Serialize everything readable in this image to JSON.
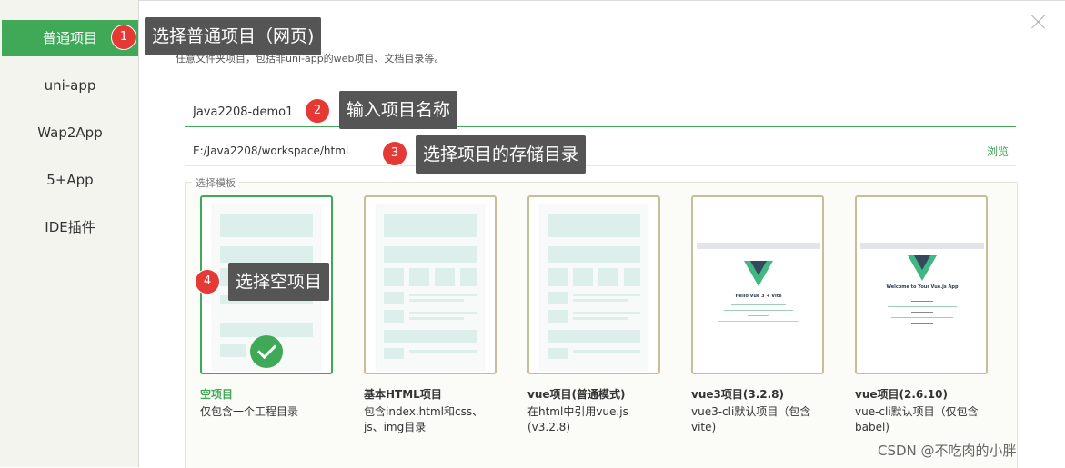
{
  "sidebar": {
    "items": [
      {
        "label": "普通项目",
        "active": true
      },
      {
        "label": "uni-app"
      },
      {
        "label": "Wap2App"
      },
      {
        "label": "5+App"
      },
      {
        "label": "IDE插件"
      }
    ]
  },
  "form": {
    "description": "任意文件夹项目，包括非uni-app的web项目、文档目录等。",
    "project_name": "Java2208-demo1",
    "project_path": "E:/Java2208/workspace/html",
    "browse_label": "浏览",
    "template_legend": "选择模板"
  },
  "templates": [
    {
      "title": "空项目",
      "desc": "仅包含一个工程目录",
      "selected": true
    },
    {
      "title": "基本HTML项目",
      "desc": "包含index.html和css、js、img目录"
    },
    {
      "title": "vue项目(普通模式)",
      "desc": "在html中引用vue.js (v3.2.8)"
    },
    {
      "title": "vue3项目(3.2.8)",
      "desc": "vue3-cli默认项目（包含vite)",
      "preview_title": "Hello Vue 3 + Vite"
    },
    {
      "title": "vue项目(2.6.10)",
      "desc": "vue-cli默认项目（仅包含babel)",
      "preview_title": "Welcome to Your Vue.js App"
    }
  ],
  "annotations": [
    {
      "num": "1",
      "text": "选择普通项目（网页)"
    },
    {
      "num": "2",
      "text": "输入项目名称"
    },
    {
      "num": "3",
      "text": "选择项目的存储目录"
    },
    {
      "num": "4",
      "text": "选择空项目"
    }
  ],
  "watermark": "CSDN @不吃肉的小胖",
  "colors": {
    "accent": "#3fa957",
    "callout_bg": "#555555",
    "badge": "#e53935",
    "card_border": "#c8bd9b"
  }
}
